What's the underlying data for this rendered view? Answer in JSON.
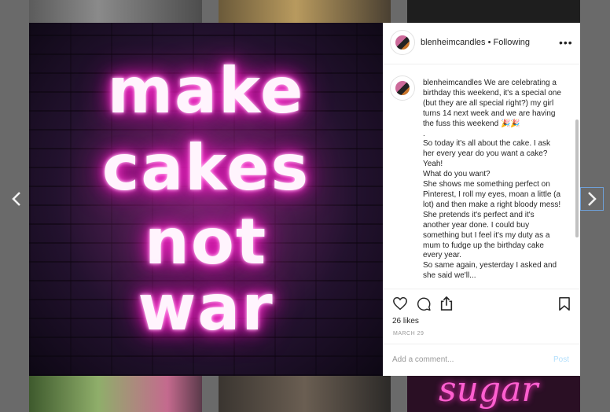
{
  "background": {
    "bottom_right_tile_text": "sugar"
  },
  "nav": {
    "prev_icon": "chevron-left-icon",
    "next_icon": "chevron-right-icon"
  },
  "post_image": {
    "neon_lines": [
      "make",
      "cakes",
      "not",
      "war"
    ],
    "neon_color": "#ff1cc8"
  },
  "header": {
    "username": "blenheimcandles",
    "separator": " • ",
    "follow_status": "Following",
    "more_label": "•••"
  },
  "caption": {
    "username": "blenheimcandles",
    "paragraphs": [
      "We are celebrating a birthday this weekend, it's a special one (but they are all special right?) my girl turns 14 next week and we are having the fuss this weekend 🎉🎉",
      ".",
      "So today it's all about the cake. I ask her every year do you want a cake? Yeah!",
      "What do you want?",
      "She shows me something perfect on Pinterest, I roll my eyes, moan a little (a lot) and then make a right bloody mess! She pretends it's perfect and it's another year done. I could buy something but I feel it's my duty as a mum to fudge up the birthday cake every year.",
      "So same again, yesterday I asked and she said we'll..."
    ]
  },
  "actions": {
    "likes": "26 likes",
    "date": "MARCH 29"
  },
  "comment": {
    "placeholder": "Add a comment...",
    "post_label": "Post",
    "post_color": "#b2dffc"
  }
}
